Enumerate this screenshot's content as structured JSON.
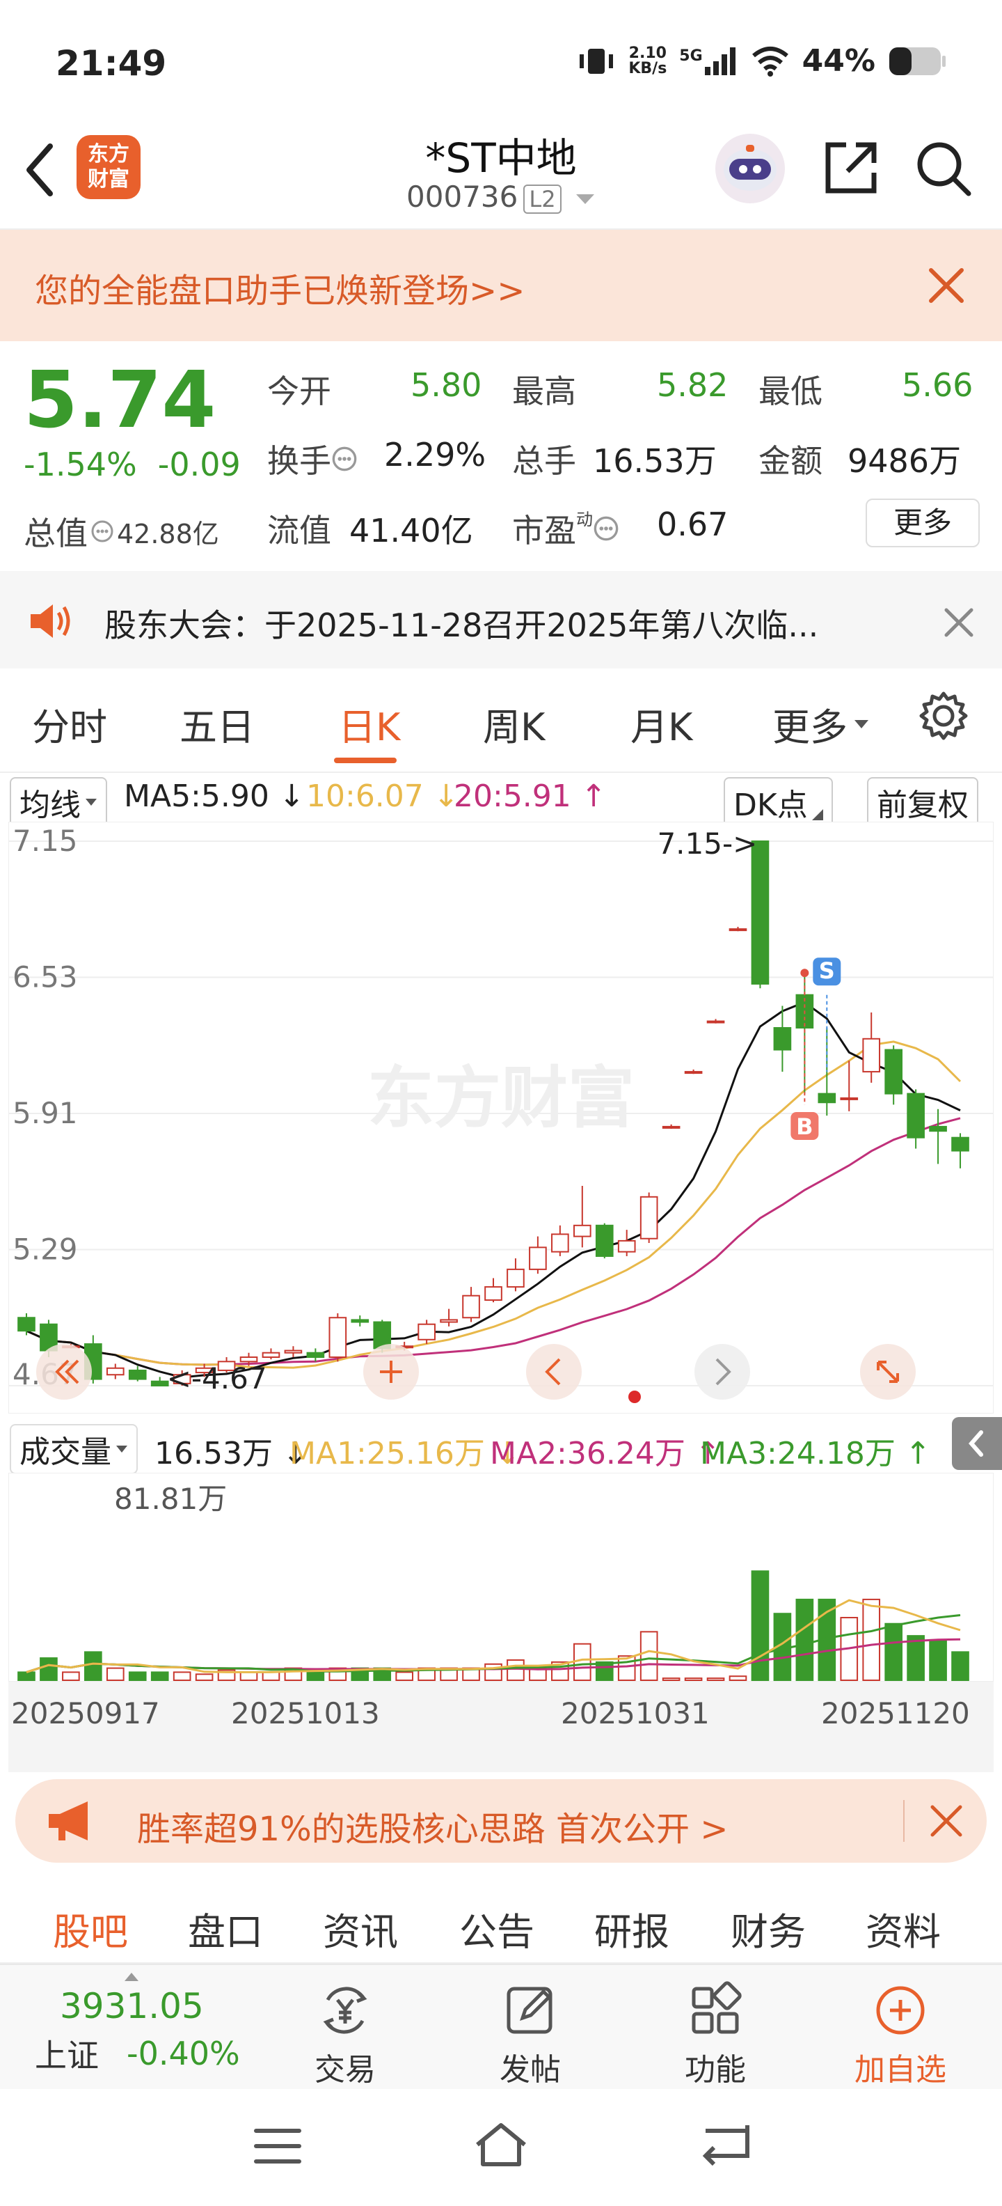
{
  "status_bar": {
    "time": "21:49",
    "net_speed_top": "2.10",
    "net_speed_bottom": "KB/s",
    "network": "5G",
    "battery": "44%"
  },
  "header": {
    "logo_text_top": "东方",
    "logo_text_bottom": "财富",
    "title": "*ST中地",
    "code": "000736",
    "level": "L2"
  },
  "banner": {
    "text": "您的全能盘口助手已焕新登场>>"
  },
  "quote": {
    "price": "5.74",
    "change_pct": "-1.54%",
    "change_abs": "-0.09",
    "total_cap_label": "总值",
    "total_cap_value": "42.88亿",
    "open_label": "今开",
    "open_value": "5.80",
    "high_label": "最高",
    "high_value": "5.82",
    "low_label": "最低",
    "low_value": "5.66",
    "turnover_label": "换手",
    "turnover_value": "2.29%",
    "volume_label": "总手",
    "volume_value": "16.53万",
    "amount_label": "金额",
    "amount_value": "9486万",
    "float_cap_label": "流值",
    "float_cap_value": "41.40亿",
    "pe_label": "市盈",
    "pe_sup": "动",
    "pe_value": "0.67",
    "more_button": "更多"
  },
  "notice": {
    "text": "股东大会：于2025-11-28召开2025年第八次临..."
  },
  "tabs": {
    "items": [
      "分时",
      "五日",
      "日K",
      "周K",
      "月K",
      "更多"
    ],
    "active": "日K"
  },
  "ma_row": {
    "selector": "均线",
    "ma5": "MA5:5.90",
    "ma10": "10:6.07",
    "ma20": "20:5.91",
    "dk_button": "DK点",
    "fq_button": "前复权"
  },
  "volume_row": {
    "selector": "成交量",
    "volume": "16.53万",
    "ma1": "MA1:25.16万",
    "ma2": "MA2:36.24万",
    "ma3": "MA3:24.18万",
    "max_label": "81.81万"
  },
  "chart_data": {
    "type": "candlestick",
    "watermark": "东方财富",
    "y_ticks": [
      "7.15",
      "6.53",
      "5.91",
      "5.29",
      "4.67"
    ],
    "ylim": [
      4.67,
      7.15
    ],
    "annotations": {
      "high_label": "7.15->",
      "low_label": "<-4.67",
      "buy_marker": "B",
      "sell_marker": "S"
    },
    "x_labels": [
      "20250917",
      "20251013",
      "20251031",
      "20251120"
    ],
    "candles": [
      {
        "o": 4.98,
        "c": 4.92,
        "h": 5.0,
        "l": 4.9
      },
      {
        "o": 4.95,
        "c": 4.83,
        "h": 4.97,
        "l": 4.8
      },
      {
        "o": 4.85,
        "c": 4.85,
        "h": 4.86,
        "l": 4.84
      },
      {
        "o": 4.86,
        "c": 4.7,
        "h": 4.9,
        "l": 4.68
      },
      {
        "o": 4.72,
        "c": 4.75,
        "h": 4.77,
        "l": 4.7
      },
      {
        "o": 4.74,
        "c": 4.7,
        "h": 4.76,
        "l": 4.69
      },
      {
        "o": 4.69,
        "c": 4.67,
        "h": 4.71,
        "l": 4.67
      },
      {
        "o": 4.68,
        "c": 4.72,
        "h": 4.74,
        "l": 4.67
      },
      {
        "o": 4.73,
        "c": 4.75,
        "h": 4.77,
        "l": 4.71
      },
      {
        "o": 4.74,
        "c": 4.78,
        "h": 4.8,
        "l": 4.73
      },
      {
        "o": 4.78,
        "c": 4.8,
        "h": 4.82,
        "l": 4.76
      },
      {
        "o": 4.8,
        "c": 4.82,
        "h": 4.84,
        "l": 4.79
      },
      {
        "o": 4.82,
        "c": 4.83,
        "h": 4.85,
        "l": 4.8
      },
      {
        "o": 4.82,
        "c": 4.8,
        "h": 4.84,
        "l": 4.78
      },
      {
        "o": 4.8,
        "c": 4.98,
        "h": 5.0,
        "l": 4.78
      },
      {
        "o": 4.97,
        "c": 4.96,
        "h": 4.99,
        "l": 4.94
      },
      {
        "o": 4.96,
        "c": 4.84,
        "h": 4.97,
        "l": 4.82
      },
      {
        "o": 4.85,
        "c": 4.85,
        "h": 4.87,
        "l": 4.83
      },
      {
        "o": 4.88,
        "c": 4.95,
        "h": 4.97,
        "l": 4.86
      },
      {
        "o": 4.96,
        "c": 4.97,
        "h": 5.02,
        "l": 4.94
      },
      {
        "o": 4.98,
        "c": 5.08,
        "h": 5.12,
        "l": 4.96
      },
      {
        "o": 5.06,
        "c": 5.12,
        "h": 5.16,
        "l": 5.05
      },
      {
        "o": 5.12,
        "c": 5.2,
        "h": 5.25,
        "l": 5.1
      },
      {
        "o": 5.2,
        "c": 5.3,
        "h": 5.35,
        "l": 5.18
      },
      {
        "o": 5.28,
        "c": 5.36,
        "h": 5.4,
        "l": 5.26
      },
      {
        "o": 5.35,
        "c": 5.4,
        "h": 5.58,
        "l": 5.3
      },
      {
        "o": 5.4,
        "c": 5.26,
        "h": 5.41,
        "l": 5.25
      },
      {
        "o": 5.28,
        "c": 5.33,
        "h": 5.38,
        "l": 5.26
      },
      {
        "o": 5.34,
        "c": 5.53,
        "h": 5.55,
        "l": 5.32
      },
      {
        "o": 5.85,
        "c": 5.85,
        "h": 5.86,
        "l": 5.84
      },
      {
        "o": 6.1,
        "c": 6.1,
        "h": 6.11,
        "l": 6.09
      },
      {
        "o": 6.33,
        "c": 6.33,
        "h": 6.34,
        "l": 6.32
      },
      {
        "o": 6.75,
        "c": 6.75,
        "h": 6.76,
        "l": 6.74
      },
      {
        "o": 7.15,
        "c": 6.5,
        "h": 7.15,
        "l": 6.48
      },
      {
        "o": 6.3,
        "c": 6.2,
        "h": 6.4,
        "l": 6.1
      },
      {
        "o": 6.45,
        "c": 6.3,
        "h": 6.55,
        "l": 6.0
      },
      {
        "o": 6.0,
        "c": 5.96,
        "h": 6.3,
        "l": 5.9
      },
      {
        "o": 5.98,
        "c": 5.98,
        "h": 6.15,
        "l": 5.92
      },
      {
        "o": 6.1,
        "c": 6.25,
        "h": 6.37,
        "l": 6.05
      },
      {
        "o": 6.2,
        "c": 6.0,
        "h": 6.22,
        "l": 5.95
      },
      {
        "o": 6.0,
        "c": 5.8,
        "h": 6.02,
        "l": 5.75
      },
      {
        "o": 5.85,
        "c": 5.83,
        "h": 5.93,
        "l": 5.68
      },
      {
        "o": 5.8,
        "c": 5.74,
        "h": 5.82,
        "l": 5.66
      }
    ],
    "volumes": [
      4,
      11,
      4,
      14,
      6,
      4,
      4,
      4,
      3,
      5,
      4,
      4,
      6,
      4,
      6,
      6,
      6,
      4,
      6,
      6,
      6,
      8,
      10,
      6,
      9,
      18,
      9,
      12,
      24,
      1,
      1,
      1,
      2,
      54,
      33,
      40,
      40,
      31,
      40,
      28,
      22,
      20,
      14
    ]
  },
  "promo": {
    "text": "胜率超91%的选股核心思路 首次公开 >"
  },
  "subtabs": {
    "items": [
      "股吧",
      "盘口",
      "资讯",
      "公告",
      "研报",
      "财务",
      "资料"
    ],
    "active": "股吧"
  },
  "toolbar": {
    "index_value": "3931.05",
    "index_name": "上证",
    "index_change": "-0.40%",
    "trade": "交易",
    "post": "发帖",
    "features": "功能",
    "add_watch": "加自选"
  },
  "colors": {
    "accent": "#e8602c",
    "up": "#c8372d",
    "down": "#3a9a2c",
    "ma5": "#111111",
    "ma10": "#e8b84a",
    "ma20": "#c0307a"
  }
}
